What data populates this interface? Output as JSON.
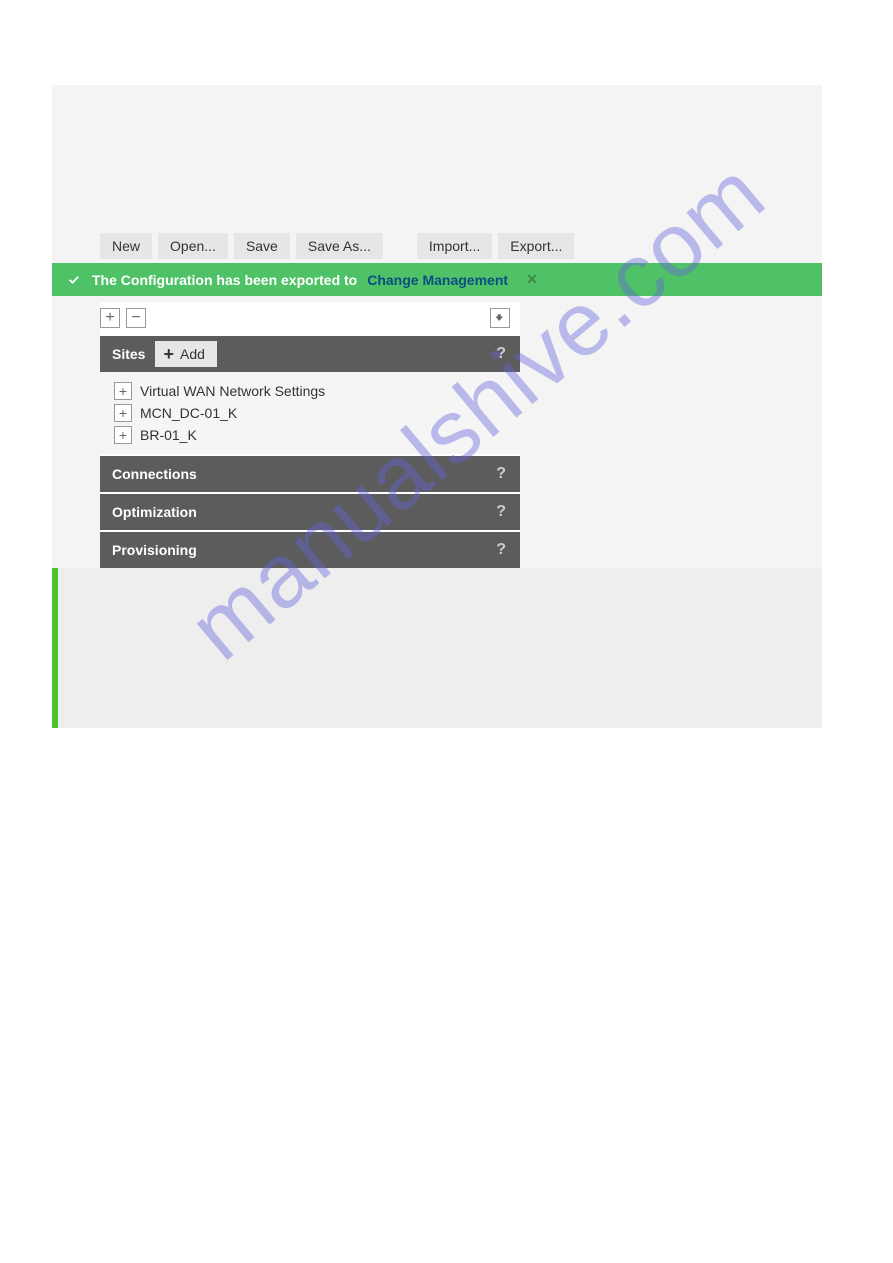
{
  "toolbar": {
    "new": "New",
    "open": "Open...",
    "save": "Save",
    "save_as": "Save As...",
    "import": "Import...",
    "export": "Export..."
  },
  "banner": {
    "message": "The Configuration has been exported to",
    "link": "Change Management"
  },
  "sections": {
    "sites": {
      "label": "Sites",
      "add": "Add",
      "items": [
        {
          "label": "Virtual WAN Network Settings"
        },
        {
          "label": "MCN_DC-01_K"
        },
        {
          "label": "BR-01_K"
        }
      ]
    },
    "connections": {
      "label": "Connections"
    },
    "optimization": {
      "label": "Optimization"
    },
    "provisioning": {
      "label": "Provisioning"
    }
  },
  "watermark": "manualshive.com"
}
